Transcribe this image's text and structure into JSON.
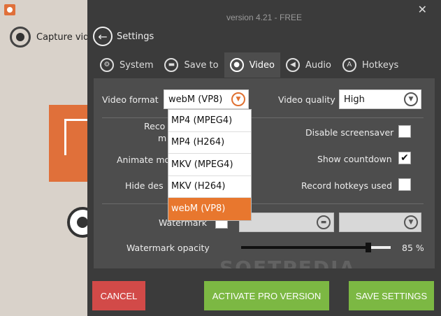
{
  "background": {
    "capture_label": "Capture vide"
  },
  "header": {
    "version": "version 4.21 - FREE",
    "close_icon": "close-icon",
    "back_label": "Settings"
  },
  "tabs": [
    {
      "label": "System",
      "icon": "gear-icon"
    },
    {
      "label": "Save to",
      "icon": "folder-icon"
    },
    {
      "label": "Video",
      "icon": "record-icon",
      "active": true
    },
    {
      "label": "Audio",
      "icon": "speaker-icon"
    },
    {
      "label": "Hotkeys",
      "icon": "keyboard-icon"
    }
  ],
  "video": {
    "format_label": "Video format",
    "format_value": "webM (VP8)",
    "quality_label": "Video quality",
    "quality_value": "High",
    "format_options": [
      "MP4 (MPEG4)",
      "MP4 (H264)",
      "MKV (MPEG4)",
      "MKV (H264)",
      "webM (VP8)"
    ],
    "left_labels": {
      "record_partial": "Reco",
      "record_partial2": "m",
      "animate_partial": "Animate mo",
      "hide_partial": "Hide des"
    },
    "disable_screensaver_label": "Disable screensaver",
    "disable_screensaver_checked": false,
    "show_countdown_label": "Show countdown",
    "show_countdown_checked": true,
    "record_hotkeys_label": "Record hotkeys used",
    "record_hotkeys_checked": false,
    "watermark_label": "Watermark",
    "watermark_checked": false,
    "watermark_opacity_label": "Watermark opacity",
    "watermark_opacity_value": "85 %",
    "watermark_opacity_fraction": 0.85,
    "overlay_text": "SOFTPEDIA"
  },
  "footer": {
    "cancel_label": "CANCEL",
    "pro_label": "ACTIVATE PRO VERSION",
    "save_label": "SAVE SETTINGS"
  },
  "colors": {
    "accent": "#e8772e",
    "cancel": "#d24a48",
    "action": "#7cb843"
  }
}
